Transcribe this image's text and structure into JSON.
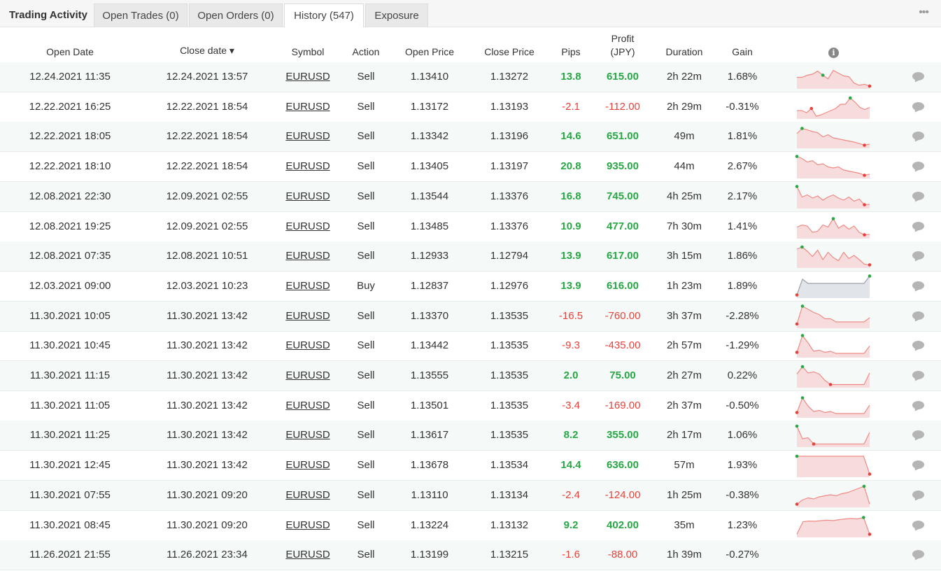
{
  "tabs": [
    {
      "label": "Trading Activity"
    },
    {
      "label": "Open Trades (0)"
    },
    {
      "label": "Open Orders (0)"
    },
    {
      "label": "History (547)"
    },
    {
      "label": "Exposure"
    }
  ],
  "more_label": "•••",
  "columns": {
    "open_date": "Open Date",
    "close_date": "Close date ▾",
    "symbol": "Symbol",
    "action": "Action",
    "open_price": "Open Price",
    "close_price": "Close Price",
    "pips": "Pips",
    "profit_line1": "Profit",
    "profit_line2": "(JPY)",
    "duration": "Duration",
    "gain": "Gain",
    "info": "i"
  },
  "colors": {
    "positive": "#28a745",
    "negative": "#e8413a",
    "spark_fill": "#f6dcdc",
    "spark_line": "#f08a85",
    "buy_fill": "#e1e4e8",
    "buy_line": "#9aa1aa"
  },
  "rows": [
    {
      "open": "12.24.2021 11:35",
      "close": "12.24.2021 13:57",
      "symbol": "EURUSD",
      "action": "Sell",
      "open_price": "1.13410",
      "close_price": "1.13272",
      "pips": "13.8",
      "profit": "615.00",
      "duration": "2h 22m",
      "gain": "1.68%",
      "positive": true,
      "spark": [
        0.55,
        0.55,
        0.45,
        0.4,
        0.25,
        0.45,
        0.62,
        0.22,
        0.35,
        0.48,
        0.52,
        0.82,
        0.93,
        0.88,
        0.97
      ],
      "spark_max": 5,
      "spark_min": 14
    },
    {
      "open": "12.22.2021 16:25",
      "close": "12.22.2021 18:54",
      "symbol": "EURUSD",
      "action": "Sell",
      "open_price": "1.13172",
      "close_price": "1.13193",
      "pips": "-2.1",
      "profit": "-112.00",
      "duration": "2h 29m",
      "gain": "-0.31%",
      "positive": false,
      "spark": [
        0.7,
        0.7,
        0.8,
        0.6,
        0.97,
        0.9,
        0.8,
        0.7,
        0.6,
        0.4,
        0.4,
        0.1,
        0.3,
        0.55,
        0.65,
        0.55
      ],
      "spark_max": 11,
      "spark_min": 3
    },
    {
      "open": "12.22.2021 18:05",
      "close": "12.22.2021 18:54",
      "symbol": "EURUSD",
      "action": "Sell",
      "open_price": "1.13342",
      "close_price": "1.13196",
      "pips": "14.6",
      "profit": "651.00",
      "duration": "49m",
      "gain": "1.81%",
      "positive": true,
      "spark": [
        0.4,
        0.15,
        0.22,
        0.3,
        0.35,
        0.55,
        0.45,
        0.6,
        0.65,
        0.7,
        0.75,
        0.8,
        0.87,
        0.95,
        0.9
      ],
      "spark_max": 1,
      "spark_min": 13
    },
    {
      "open": "12.22.2021 18:10",
      "close": "12.22.2021 18:54",
      "symbol": "EURUSD",
      "action": "Sell",
      "open_price": "1.13405",
      "close_price": "1.13197",
      "pips": "20.8",
      "profit": "935.00",
      "duration": "44m",
      "gain": "2.67%",
      "positive": true,
      "spark": [
        0.05,
        0.15,
        0.32,
        0.25,
        0.45,
        0.4,
        0.55,
        0.6,
        0.55,
        0.7,
        0.75,
        0.8,
        0.85,
        0.95,
        0.9
      ],
      "spark_max": 0,
      "spark_min": 13
    },
    {
      "open": "12.08.2021 22:30",
      "close": "12.09.2021 02:55",
      "symbol": "EURUSD",
      "action": "Sell",
      "open_price": "1.13544",
      "close_price": "1.13376",
      "pips": "16.8",
      "profit": "745.00",
      "duration": "4h 25m",
      "gain": "2.17%",
      "positive": true,
      "spark": [
        0.05,
        0.55,
        0.45,
        0.6,
        0.5,
        0.7,
        0.55,
        0.45,
        0.6,
        0.7,
        0.55,
        0.75,
        0.65,
        0.92,
        0.9
      ],
      "spark_max": 0,
      "spark_min": 13
    },
    {
      "open": "12.08.2021 19:25",
      "close": "12.09.2021 02:55",
      "symbol": "EURUSD",
      "action": "Sell",
      "open_price": "1.13485",
      "close_price": "1.13376",
      "pips": "10.9",
      "profit": "477.00",
      "duration": "7h 30m",
      "gain": "1.41%",
      "positive": true,
      "spark": [
        0.55,
        0.45,
        0.5,
        0.8,
        0.75,
        0.45,
        0.55,
        0.15,
        0.6,
        0.45,
        0.65,
        0.5,
        0.8,
        0.92,
        0.9
      ],
      "spark_max": 7,
      "spark_min": 13
    },
    {
      "open": "12.08.2021 07:35",
      "close": "12.08.2021 10:51",
      "symbol": "EURUSD",
      "action": "Sell",
      "open_price": "1.12933",
      "close_price": "1.12794",
      "pips": "13.9",
      "profit": "617.00",
      "duration": "3h 15m",
      "gain": "1.86%",
      "positive": true,
      "spark": [
        0.2,
        0.1,
        0.3,
        0.55,
        0.25,
        0.7,
        0.35,
        0.6,
        0.75,
        0.35,
        0.65,
        0.5,
        0.7,
        0.92,
        0.95
      ],
      "spark_max": 1,
      "spark_min": 14
    },
    {
      "open": "12.03.2021 09:00",
      "close": "12.03.2021 10:23",
      "symbol": "EURUSD",
      "action": "Buy",
      "open_price": "1.12837",
      "close_price": "1.12976",
      "pips": "13.9",
      "profit": "616.00",
      "duration": "1h 23m",
      "gain": "1.89%",
      "positive": true,
      "buy": true,
      "spark": [
        0.95,
        0.2,
        0.4,
        0.4,
        0.4,
        0.4,
        0.4,
        0.4,
        0.4,
        0.4,
        0.4,
        0.4,
        0.4,
        0.05
      ],
      "spark_max": 13,
      "spark_min": 0
    },
    {
      "open": "11.30.2021 10:05",
      "close": "11.30.2021 13:42",
      "symbol": "EURUSD",
      "action": "Sell",
      "open_price": "1.13370",
      "close_price": "1.13535",
      "pips": "-16.5",
      "profit": "-760.00",
      "duration": "3h 37m",
      "gain": "-2.28%",
      "positive": false,
      "spark": [
        0.9,
        0.05,
        0.2,
        0.35,
        0.45,
        0.65,
        0.65,
        0.8,
        0.8,
        0.8,
        0.8,
        0.8,
        0.8,
        0.6
      ],
      "spark_max": 1,
      "spark_min": 0
    },
    {
      "open": "11.30.2021 10:45",
      "close": "11.30.2021 13:42",
      "symbol": "EURUSD",
      "action": "Sell",
      "open_price": "1.13442",
      "close_price": "1.13535",
      "pips": "-9.3",
      "profit": "-435.00",
      "duration": "2h 57m",
      "gain": "-1.29%",
      "positive": false,
      "spark": [
        0.85,
        0.05,
        0.4,
        0.8,
        0.75,
        0.85,
        0.8,
        0.9,
        0.9,
        0.9,
        0.9,
        0.9,
        0.9,
        0.55
      ],
      "spark_max": 1,
      "spark_min": 0
    },
    {
      "open": "11.30.2021 11:15",
      "close": "11.30.2021 13:42",
      "symbol": "EURUSD",
      "action": "Sell",
      "open_price": "1.13555",
      "close_price": "1.13535",
      "pips": "2.0",
      "profit": "75.00",
      "duration": "2h 27m",
      "gain": "0.22%",
      "positive": true,
      "spark": [
        0.45,
        0.1,
        0.4,
        0.35,
        0.45,
        0.75,
        0.95,
        0.95,
        0.95,
        0.95,
        0.95,
        0.95,
        0.95,
        0.4
      ],
      "spark_max": 1,
      "spark_min": 6
    },
    {
      "open": "11.30.2021 11:05",
      "close": "11.30.2021 13:42",
      "symbol": "EURUSD",
      "action": "Sell",
      "open_price": "1.13501",
      "close_price": "1.13535",
      "pips": "-3.4",
      "profit": "-169.00",
      "duration": "2h 37m",
      "gain": "-0.50%",
      "positive": false,
      "spark": [
        0.85,
        0.15,
        0.55,
        0.8,
        0.75,
        0.85,
        0.8,
        0.9,
        0.9,
        0.9,
        0.9,
        0.9,
        0.9,
        0.5
      ],
      "spark_max": 1,
      "spark_min": 0
    },
    {
      "open": "11.30.2021 11:25",
      "close": "11.30.2021 13:42",
      "symbol": "EURUSD",
      "action": "Sell",
      "open_price": "1.13617",
      "close_price": "1.13535",
      "pips": "8.2",
      "profit": "355.00",
      "duration": "2h 17m",
      "gain": "1.06%",
      "positive": true,
      "spark": [
        0.1,
        0.7,
        0.65,
        0.95,
        0.95,
        0.95,
        0.95,
        0.95,
        0.95,
        0.95,
        0.95,
        0.95,
        0.95,
        0.4
      ],
      "spark_max": 0,
      "spark_min": 3
    },
    {
      "open": "11.30.2021 12:45",
      "close": "11.30.2021 13:42",
      "symbol": "EURUSD",
      "action": "Sell",
      "open_price": "1.13678",
      "close_price": "1.13534",
      "pips": "14.4",
      "profit": "636.00",
      "duration": "57m",
      "gain": "1.93%",
      "positive": true,
      "spark": [
        0.1,
        0.1,
        0.1,
        0.1,
        0.1,
        0.1,
        0.1,
        0.1,
        0.1,
        0.1,
        0.1,
        0.1,
        0.95
      ],
      "spark_max": 0,
      "spark_min": 12
    },
    {
      "open": "11.30.2021 07:55",
      "close": "11.30.2021 09:20",
      "symbol": "EURUSD",
      "action": "Sell",
      "open_price": "1.13110",
      "close_price": "1.13134",
      "pips": "-2.4",
      "profit": "-124.00",
      "duration": "1h 25m",
      "gain": "-0.38%",
      "positive": false,
      "spark": [
        0.95,
        0.75,
        0.65,
        0.7,
        0.6,
        0.55,
        0.5,
        0.55,
        0.45,
        0.4,
        0.3,
        0.2,
        0.1,
        0.95
      ],
      "spark_max": 12,
      "spark_min": 0
    },
    {
      "open": "11.30.2021 08:45",
      "close": "11.30.2021 09:20",
      "symbol": "EURUSD",
      "action": "Sell",
      "open_price": "1.13224",
      "close_price": "1.13132",
      "pips": "9.2",
      "profit": "402.00",
      "duration": "35m",
      "gain": "1.23%",
      "positive": true,
      "spark": [
        0.95,
        0.35,
        0.32,
        0.33,
        0.3,
        0.28,
        0.3,
        0.25,
        0.22,
        0.2,
        0.22,
        0.15,
        0.95
      ],
      "spark_max": 11,
      "spark_min": 12
    },
    {
      "open": "11.26.2021 21:55",
      "close": "11.26.2021 23:34",
      "symbol": "EURUSD",
      "action": "Sell",
      "open_price": "1.13199",
      "close_price": "1.13215",
      "pips": "-1.6",
      "profit": "-88.00",
      "duration": "1h 39m",
      "gain": "-0.27%",
      "positive": false,
      "spark": null
    }
  ]
}
